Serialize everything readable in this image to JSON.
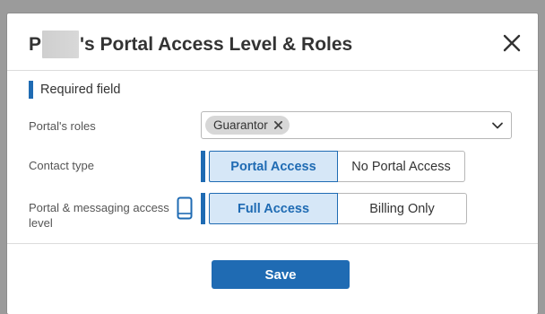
{
  "dialog": {
    "title_prefix": "P",
    "title_suffix": "'s Portal Access Level & Roles",
    "required_label": "Required field"
  },
  "fields": {
    "roles": {
      "label": "Portal's roles",
      "chips": [
        "Guarantor"
      ]
    },
    "contact_type": {
      "label": "Contact type",
      "options": [
        "Portal Access",
        "No Portal Access"
      ],
      "selected": "Portal Access"
    },
    "access_level": {
      "label_line1": "Portal & messaging access",
      "label_line2": "level",
      "options": [
        "Full Access",
        "Billing Only"
      ],
      "selected": "Full Access"
    }
  },
  "footer": {
    "save_label": "Save"
  },
  "icons": {
    "close": "close-icon",
    "chip_remove": "close-icon",
    "dropdown": "chevron-down-icon",
    "mobile": "mobile-device-icon"
  },
  "colors": {
    "accent": "#1f6bb3",
    "accent_light": "#d6e7f7"
  }
}
